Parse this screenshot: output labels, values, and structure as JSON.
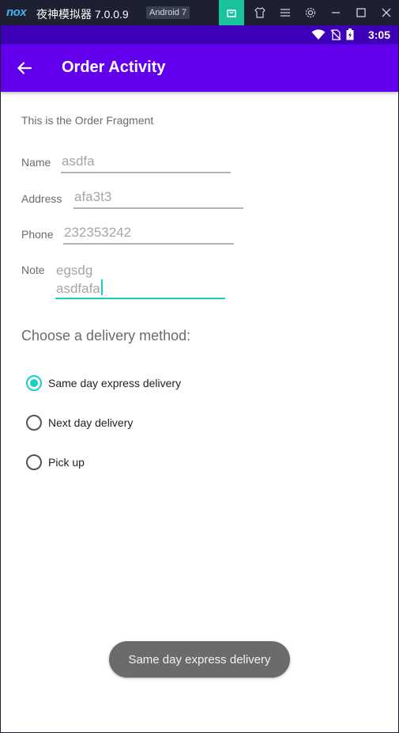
{
  "emulator": {
    "logo": "nox",
    "title": "夜神模拟器 7.0.0.9",
    "badge": "Android 7",
    "icons": [
      "shopping-bag-icon",
      "shirt-icon",
      "menu-icon",
      "settings-icon",
      "minimize-icon",
      "maximize-icon",
      "close-icon"
    ]
  },
  "status_bar": {
    "time": "3:05",
    "icons": [
      "wifi-icon",
      "no-sim-icon",
      "battery-charging-icon"
    ]
  },
  "app_bar": {
    "title": "Order Activity",
    "back_icon": "arrow-back-icon"
  },
  "fragment": {
    "intro": "This is the Order Fragment"
  },
  "form": {
    "name": {
      "label": "Name",
      "value": "asdfa"
    },
    "address": {
      "label": "Address",
      "value": "afa3t3"
    },
    "phone": {
      "label": "Phone",
      "value": "232353242"
    },
    "note": {
      "label": "Note",
      "line1": "egsdg",
      "line2": "asdfafa"
    }
  },
  "delivery": {
    "heading": "Choose a delivery method:",
    "options": [
      {
        "label": "Same day express delivery",
        "checked": true
      },
      {
        "label": "Next day delivery",
        "checked": false
      },
      {
        "label": "Pick up",
        "checked": false
      }
    ]
  },
  "toast": {
    "text": "Same day express delivery"
  },
  "colors": {
    "primary": "#6200ee",
    "primary_dark": "#3d00b8",
    "accent": "#18d0c4",
    "emulator_active": "#19c39b"
  }
}
